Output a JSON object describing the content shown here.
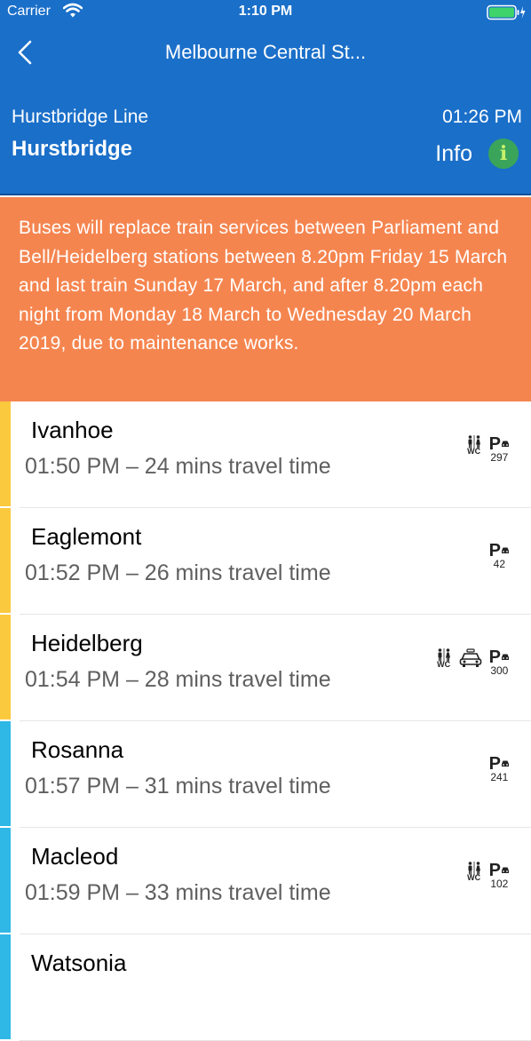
{
  "status_bar": {
    "carrier": "Carrier",
    "time": "1:10 PM"
  },
  "nav": {
    "title": "Melbourne Central St..."
  },
  "header": {
    "line_name": "Hurstbridge Line",
    "destination": "Hurstbridge",
    "departure_time": "01:26 PM",
    "info_label": "Info",
    "info_icon_glyph": "i"
  },
  "alert": {
    "text": "Buses will replace train services between Parliament and Bell/Heidelberg stations between 8.20pm Friday 15 March and last train Sunday 17 March, and after 8.20pm each night from Monday 18 March to Wednesday 20 March 2019, due to maintenance works."
  },
  "colors": {
    "header": "#1a6fc9",
    "alert": "#f5854f",
    "info": "#3aa55a"
  },
  "stops": [
    {
      "name": "Ivanhoe",
      "travel": "01:50 PM – 24 mins travel time",
      "color": "#fbc93d",
      "wc_label": "WC",
      "wc": true,
      "taxi": false,
      "parking_label": "P",
      "parking": "297"
    },
    {
      "name": "Eaglemont",
      "travel": "01:52 PM – 26 mins travel time",
      "color": "#fbc93d",
      "wc_label": "",
      "wc": false,
      "taxi": false,
      "parking_label": "P",
      "parking": "42"
    },
    {
      "name": "Heidelberg",
      "travel": "01:54 PM – 28 mins travel time",
      "color": "#fbc93d",
      "wc_label": "WC",
      "wc": true,
      "taxi": true,
      "parking_label": "P",
      "parking": "300"
    },
    {
      "name": "Rosanna",
      "travel": "01:57 PM – 31 mins travel time",
      "color": "#2fb8e6",
      "wc_label": "",
      "wc": false,
      "taxi": false,
      "parking_label": "P",
      "parking": "241"
    },
    {
      "name": "Macleod",
      "travel": "01:59 PM – 33 mins travel time",
      "color": "#2fb8e6",
      "wc_label": "WC",
      "wc": true,
      "taxi": false,
      "parking_label": "P",
      "parking": "102"
    },
    {
      "name": "Watsonia",
      "travel": "",
      "color": "#2fb8e6",
      "wc_label": "",
      "wc": false,
      "taxi": false,
      "parking_label": "",
      "parking": ""
    }
  ]
}
